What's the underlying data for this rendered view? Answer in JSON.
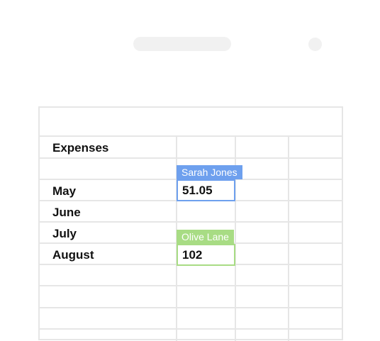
{
  "sheet": {
    "rows": [
      {
        "label": "Expenses"
      },
      {
        "label": ""
      },
      {
        "label": "May"
      },
      {
        "label": "June"
      },
      {
        "label": "July"
      },
      {
        "label": "August"
      }
    ]
  },
  "collaborators": [
    {
      "name": "Sarah Jones",
      "color": "#6ea0ee",
      "cell_value": "51.05"
    },
    {
      "name": "Olive Lane",
      "color": "#a8dc84",
      "cell_value": "102"
    }
  ]
}
